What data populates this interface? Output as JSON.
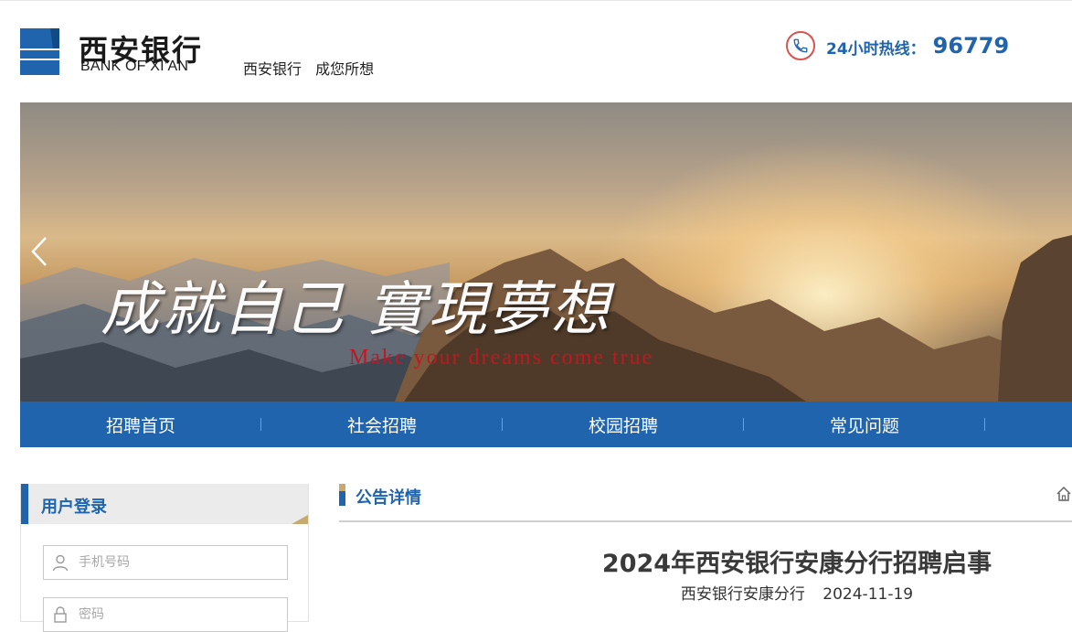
{
  "header": {
    "logo_cn": "西安银行",
    "logo_en": "BANK OF XI’AN",
    "slogan": "西安银行 成您所想",
    "hotline_label": "24小时热线：",
    "hotline_number": "96779"
  },
  "banner": {
    "title": "成就自己 實現夢想",
    "subtitle": "Make your dreams come true"
  },
  "nav": {
    "items": [
      {
        "label": "招聘首页"
      },
      {
        "label": "社会招聘"
      },
      {
        "label": "校园招聘"
      },
      {
        "label": "常见问题"
      }
    ]
  },
  "login": {
    "title": "用户登录",
    "phone_placeholder": "手机号码",
    "password_placeholder": "密码"
  },
  "announcement": {
    "section_title": "公告详情",
    "title": "2024年西安银行安康分行招聘启事",
    "source": "西安银行安康分行",
    "date": "2024-11-19"
  },
  "colors": {
    "brand_blue": "#1f64ad",
    "accent_gold": "#c8a96e",
    "banner_text_red": "#c8141e",
    "phone_ring_red": "#d9534f"
  },
  "icons": [
    "logo-mark-icon",
    "phone-icon",
    "chevron-left-icon",
    "user-icon",
    "lock-icon",
    "home-icon"
  ]
}
